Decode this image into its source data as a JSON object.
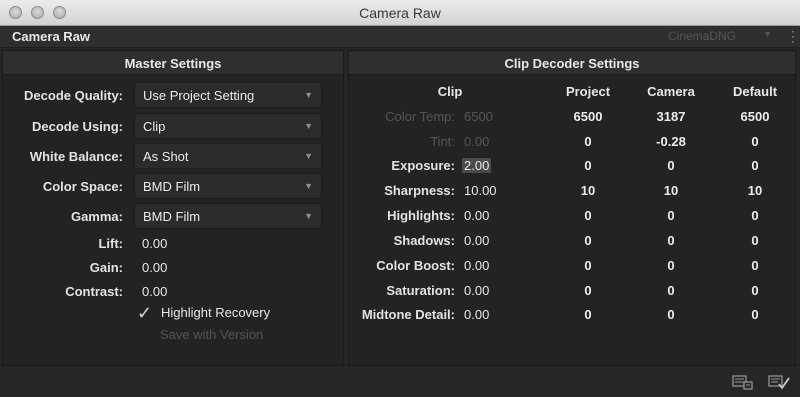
{
  "window": {
    "title": "Camera Raw"
  },
  "header": {
    "title": "Camera Raw",
    "codec": "CinemaDNG"
  },
  "master": {
    "heading": "Master Settings",
    "decode_quality": {
      "label": "Decode Quality:",
      "value": "Use Project Setting"
    },
    "decode_using": {
      "label": "Decode Using:",
      "value": "Clip"
    },
    "white_balance": {
      "label": "White Balance:",
      "value": "As Shot"
    },
    "color_space": {
      "label": "Color Space:",
      "value": "BMD Film"
    },
    "gamma": {
      "label": "Gamma:",
      "value": "BMD Film"
    },
    "lift": {
      "label": "Lift:",
      "value": "0.00"
    },
    "gain": {
      "label": "Gain:",
      "value": "0.00"
    },
    "contrast": {
      "label": "Contrast:",
      "value": "0.00"
    },
    "highlight_recovery": {
      "label": "Highlight Recovery",
      "checked": true
    },
    "save_with_version": "Save with Version"
  },
  "decoder": {
    "heading": "Clip Decoder Settings",
    "columns": {
      "clip": "Clip",
      "project": "Project",
      "camera": "Camera",
      "default": "Default"
    },
    "rows": [
      {
        "label": "Color Temp:",
        "clip": "6500",
        "project": "6500",
        "camera": "3187",
        "default": "6500",
        "disabled": true
      },
      {
        "label": "Tint:",
        "clip": "0.00",
        "project": "0",
        "camera": "-0.28",
        "default": "0",
        "disabled": true
      },
      {
        "label": "Exposure:",
        "clip": "2.00",
        "project": "0",
        "camera": "0",
        "default": "0"
      },
      {
        "label": "Sharpness:",
        "clip": "10.00",
        "project": "10",
        "camera": "10",
        "default": "10"
      },
      {
        "label": "Highlights:",
        "clip": "0.00",
        "project": "0",
        "camera": "0",
        "default": "0"
      },
      {
        "label": "Shadows:",
        "clip": "0.00",
        "project": "0",
        "camera": "0",
        "default": "0"
      },
      {
        "label": "Color Boost:",
        "clip": "0.00",
        "project": "0",
        "camera": "0",
        "default": "0"
      },
      {
        "label": "Saturation:",
        "clip": "0.00",
        "project": "0",
        "camera": "0",
        "default": "0"
      },
      {
        "label": "Midtone Detail:",
        "clip": "0.00",
        "project": "0",
        "camera": "0",
        "default": "0"
      }
    ]
  },
  "icons": {
    "left": "copy-settings-icon",
    "right": "apply-settings-icon"
  }
}
